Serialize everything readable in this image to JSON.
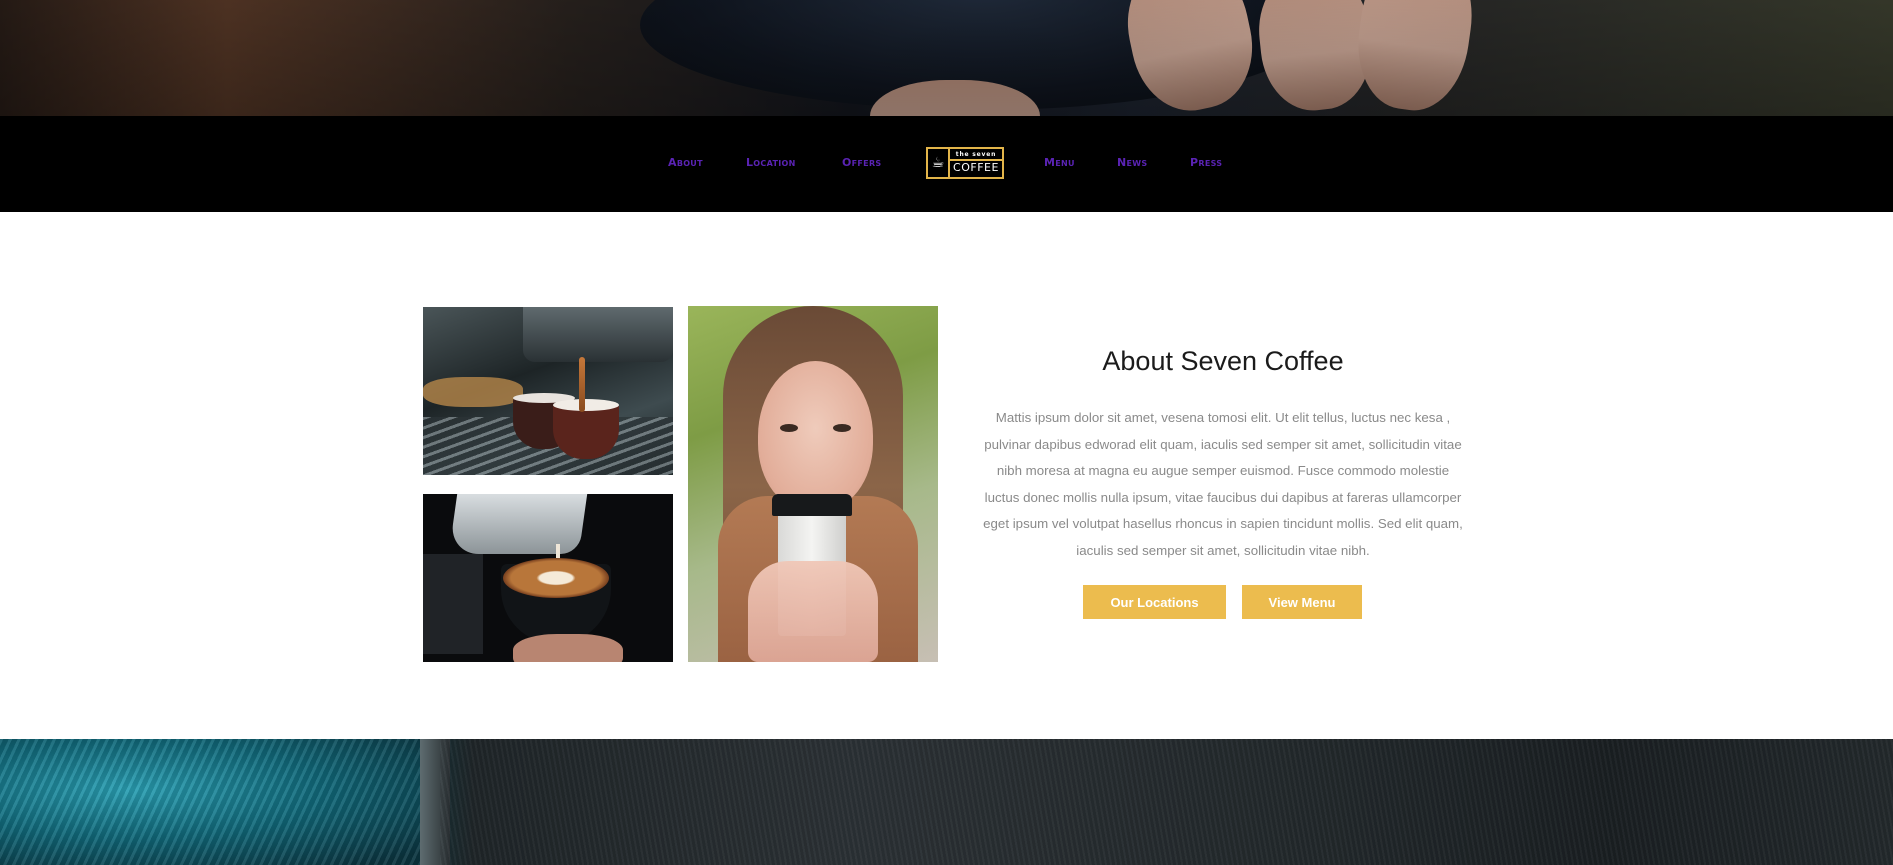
{
  "nav": {
    "left_links": [
      "About",
      "Location",
      "Offers"
    ],
    "right_links": [
      "Menu",
      "News",
      "Press"
    ],
    "link_color": "#5a23b4"
  },
  "logo": {
    "icon": "coffee-cup-icon",
    "small_text": "the seven",
    "big_text": "COFFEE",
    "accent_color": "#e3b54a"
  },
  "about": {
    "title": "About Seven Coffee",
    "body": "Mattis ipsum dolor sit amet, vesena tomosi elit. Ut elit tellus, luctus nec kesa , pulvinar dapibus edworad elit quam, iaculis sed semper sit amet, sollicitudin vitae nibh moresa at magna eu augue semper euismod. Fusce commodo molestie luctus donec mollis nulla ipsum, vitae faucibus dui dapibus at fareras ullamcorper eget ipsum vel volutpat hasellus rhoncus in sapien tincidunt mollis. Sed elit quam, iaculis sed semper sit amet, sollicitudin vitae nibh.",
    "buttons": {
      "locations": "Our Locations",
      "menu": "View Menu"
    },
    "button_color": "#ecbc4e"
  }
}
